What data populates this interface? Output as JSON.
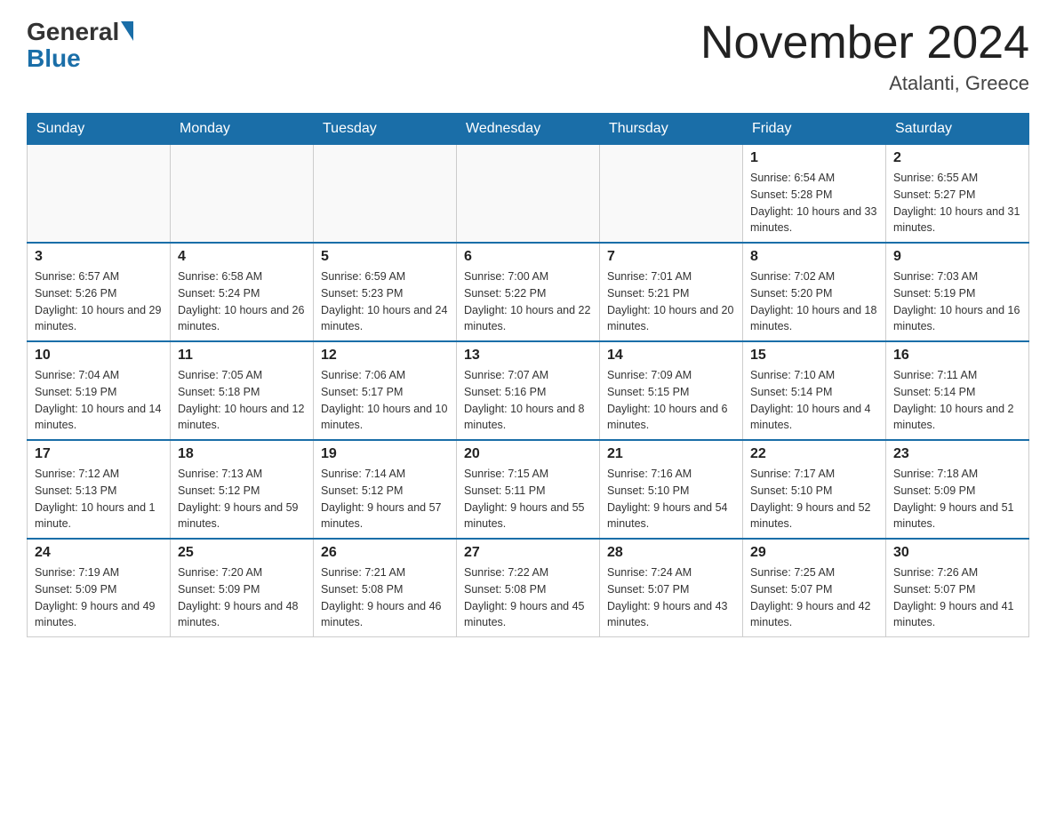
{
  "logo": {
    "general": "General",
    "blue": "Blue"
  },
  "title": "November 2024",
  "subtitle": "Atalanti, Greece",
  "days_header": [
    "Sunday",
    "Monday",
    "Tuesday",
    "Wednesday",
    "Thursday",
    "Friday",
    "Saturday"
  ],
  "weeks": [
    {
      "days": [
        {
          "num": "",
          "sunrise": "",
          "sunset": "",
          "daylight": ""
        },
        {
          "num": "",
          "sunrise": "",
          "sunset": "",
          "daylight": ""
        },
        {
          "num": "",
          "sunrise": "",
          "sunset": "",
          "daylight": ""
        },
        {
          "num": "",
          "sunrise": "",
          "sunset": "",
          "daylight": ""
        },
        {
          "num": "",
          "sunrise": "",
          "sunset": "",
          "daylight": ""
        },
        {
          "num": "1",
          "sunrise": "Sunrise: 6:54 AM",
          "sunset": "Sunset: 5:28 PM",
          "daylight": "Daylight: 10 hours and 33 minutes."
        },
        {
          "num": "2",
          "sunrise": "Sunrise: 6:55 AM",
          "sunset": "Sunset: 5:27 PM",
          "daylight": "Daylight: 10 hours and 31 minutes."
        }
      ]
    },
    {
      "days": [
        {
          "num": "3",
          "sunrise": "Sunrise: 6:57 AM",
          "sunset": "Sunset: 5:26 PM",
          "daylight": "Daylight: 10 hours and 29 minutes."
        },
        {
          "num": "4",
          "sunrise": "Sunrise: 6:58 AM",
          "sunset": "Sunset: 5:24 PM",
          "daylight": "Daylight: 10 hours and 26 minutes."
        },
        {
          "num": "5",
          "sunrise": "Sunrise: 6:59 AM",
          "sunset": "Sunset: 5:23 PM",
          "daylight": "Daylight: 10 hours and 24 minutes."
        },
        {
          "num": "6",
          "sunrise": "Sunrise: 7:00 AM",
          "sunset": "Sunset: 5:22 PM",
          "daylight": "Daylight: 10 hours and 22 minutes."
        },
        {
          "num": "7",
          "sunrise": "Sunrise: 7:01 AM",
          "sunset": "Sunset: 5:21 PM",
          "daylight": "Daylight: 10 hours and 20 minutes."
        },
        {
          "num": "8",
          "sunrise": "Sunrise: 7:02 AM",
          "sunset": "Sunset: 5:20 PM",
          "daylight": "Daylight: 10 hours and 18 minutes."
        },
        {
          "num": "9",
          "sunrise": "Sunrise: 7:03 AM",
          "sunset": "Sunset: 5:19 PM",
          "daylight": "Daylight: 10 hours and 16 minutes."
        }
      ]
    },
    {
      "days": [
        {
          "num": "10",
          "sunrise": "Sunrise: 7:04 AM",
          "sunset": "Sunset: 5:19 PM",
          "daylight": "Daylight: 10 hours and 14 minutes."
        },
        {
          "num": "11",
          "sunrise": "Sunrise: 7:05 AM",
          "sunset": "Sunset: 5:18 PM",
          "daylight": "Daylight: 10 hours and 12 minutes."
        },
        {
          "num": "12",
          "sunrise": "Sunrise: 7:06 AM",
          "sunset": "Sunset: 5:17 PM",
          "daylight": "Daylight: 10 hours and 10 minutes."
        },
        {
          "num": "13",
          "sunrise": "Sunrise: 7:07 AM",
          "sunset": "Sunset: 5:16 PM",
          "daylight": "Daylight: 10 hours and 8 minutes."
        },
        {
          "num": "14",
          "sunrise": "Sunrise: 7:09 AM",
          "sunset": "Sunset: 5:15 PM",
          "daylight": "Daylight: 10 hours and 6 minutes."
        },
        {
          "num": "15",
          "sunrise": "Sunrise: 7:10 AM",
          "sunset": "Sunset: 5:14 PM",
          "daylight": "Daylight: 10 hours and 4 minutes."
        },
        {
          "num": "16",
          "sunrise": "Sunrise: 7:11 AM",
          "sunset": "Sunset: 5:14 PM",
          "daylight": "Daylight: 10 hours and 2 minutes."
        }
      ]
    },
    {
      "days": [
        {
          "num": "17",
          "sunrise": "Sunrise: 7:12 AM",
          "sunset": "Sunset: 5:13 PM",
          "daylight": "Daylight: 10 hours and 1 minute."
        },
        {
          "num": "18",
          "sunrise": "Sunrise: 7:13 AM",
          "sunset": "Sunset: 5:12 PM",
          "daylight": "Daylight: 9 hours and 59 minutes."
        },
        {
          "num": "19",
          "sunrise": "Sunrise: 7:14 AM",
          "sunset": "Sunset: 5:12 PM",
          "daylight": "Daylight: 9 hours and 57 minutes."
        },
        {
          "num": "20",
          "sunrise": "Sunrise: 7:15 AM",
          "sunset": "Sunset: 5:11 PM",
          "daylight": "Daylight: 9 hours and 55 minutes."
        },
        {
          "num": "21",
          "sunrise": "Sunrise: 7:16 AM",
          "sunset": "Sunset: 5:10 PM",
          "daylight": "Daylight: 9 hours and 54 minutes."
        },
        {
          "num": "22",
          "sunrise": "Sunrise: 7:17 AM",
          "sunset": "Sunset: 5:10 PM",
          "daylight": "Daylight: 9 hours and 52 minutes."
        },
        {
          "num": "23",
          "sunrise": "Sunrise: 7:18 AM",
          "sunset": "Sunset: 5:09 PM",
          "daylight": "Daylight: 9 hours and 51 minutes."
        }
      ]
    },
    {
      "days": [
        {
          "num": "24",
          "sunrise": "Sunrise: 7:19 AM",
          "sunset": "Sunset: 5:09 PM",
          "daylight": "Daylight: 9 hours and 49 minutes."
        },
        {
          "num": "25",
          "sunrise": "Sunrise: 7:20 AM",
          "sunset": "Sunset: 5:09 PM",
          "daylight": "Daylight: 9 hours and 48 minutes."
        },
        {
          "num": "26",
          "sunrise": "Sunrise: 7:21 AM",
          "sunset": "Sunset: 5:08 PM",
          "daylight": "Daylight: 9 hours and 46 minutes."
        },
        {
          "num": "27",
          "sunrise": "Sunrise: 7:22 AM",
          "sunset": "Sunset: 5:08 PM",
          "daylight": "Daylight: 9 hours and 45 minutes."
        },
        {
          "num": "28",
          "sunrise": "Sunrise: 7:24 AM",
          "sunset": "Sunset: 5:07 PM",
          "daylight": "Daylight: 9 hours and 43 minutes."
        },
        {
          "num": "29",
          "sunrise": "Sunrise: 7:25 AM",
          "sunset": "Sunset: 5:07 PM",
          "daylight": "Daylight: 9 hours and 42 minutes."
        },
        {
          "num": "30",
          "sunrise": "Sunrise: 7:26 AM",
          "sunset": "Sunset: 5:07 PM",
          "daylight": "Daylight: 9 hours and 41 minutes."
        }
      ]
    }
  ]
}
